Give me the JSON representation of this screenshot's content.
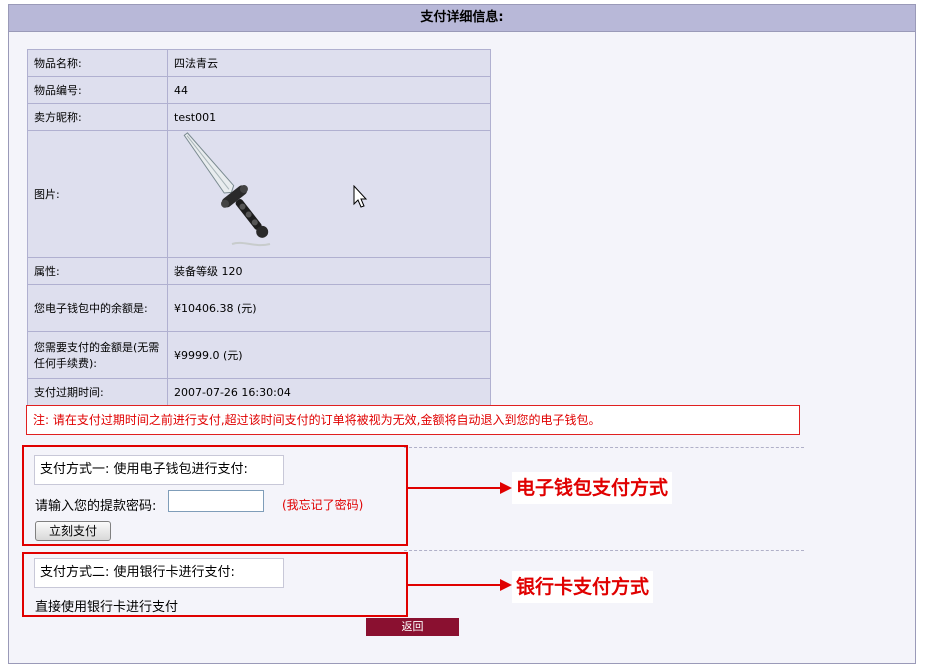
{
  "header": {
    "title": "支付详细信息:"
  },
  "item": {
    "name_label": "物品名称:",
    "name": "四法青云",
    "id_label": "物品编号:",
    "id": "44",
    "seller_label": "卖方昵称:",
    "seller": "test001",
    "image_label": "图片:",
    "attr_label": "属性:",
    "attr": "装备等级 120",
    "balance_label": "您电子钱包中的余额是:",
    "balance": "¥10406.38 (元)",
    "amount_label": "您需要支付的金额是(无需任何手续费):",
    "amount": "¥9999.0 (元)",
    "expire_label": "支付过期时间:",
    "expire": "2007-07-26 16:30:04"
  },
  "notice": "注: 请在支付过期时间之前进行支付,超过该时间支付的订单将被视为无效,金额将自动退入到您的电子钱包。",
  "method1": {
    "title": "支付方式一: 使用电子钱包进行支付:",
    "password_label": "请输入您的提款密码:",
    "password_value": "",
    "forgot_link": "(我忘记了密码)",
    "pay_button": "立刻支付",
    "callout": "电子钱包支付方式"
  },
  "method2": {
    "title": "支付方式二: 使用银行卡进行支付:",
    "desc": "直接使用银行卡进行支付",
    "callout": "银行卡支付方式"
  },
  "back_button": "返回",
  "colors": {
    "accent_red": "#e00000",
    "header_bg": "#b8b8d8",
    "table_bg": "#dedfee",
    "back_bg": "#8a1030"
  }
}
